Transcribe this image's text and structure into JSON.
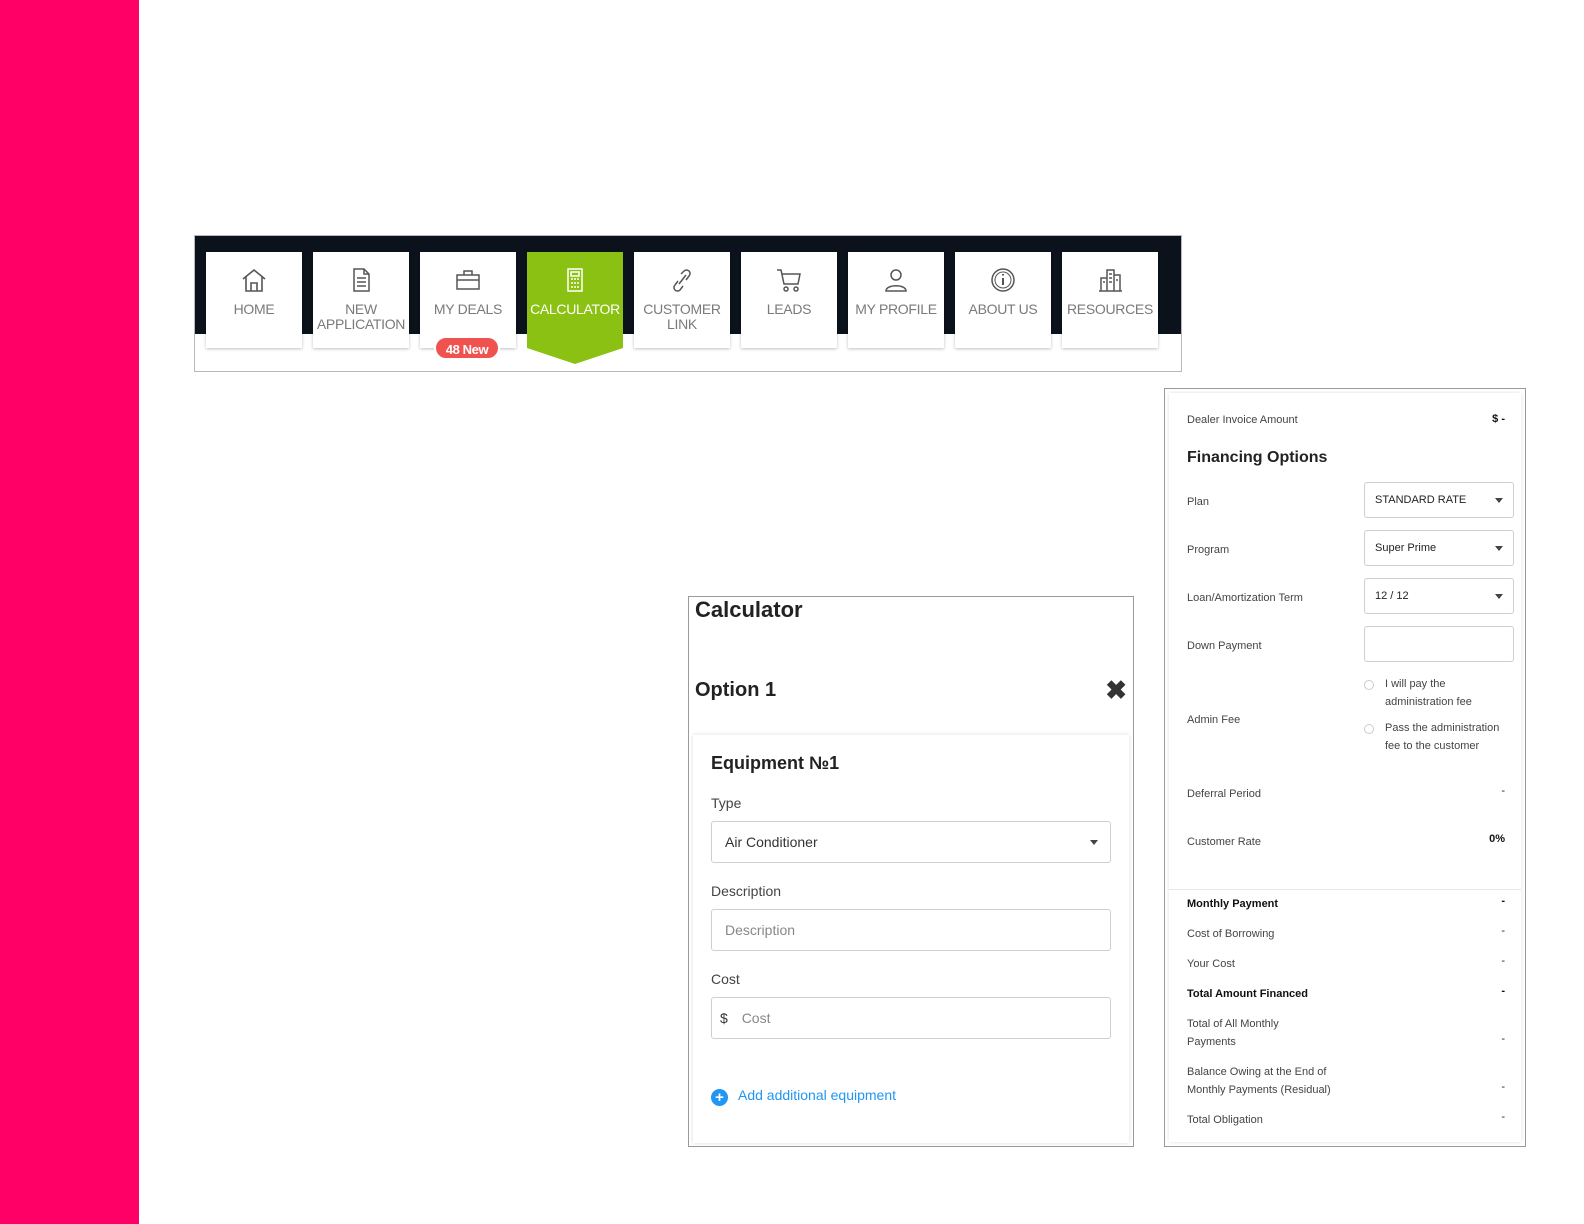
{
  "nav": {
    "items": [
      {
        "label": "HOME",
        "icon": "home-icon"
      },
      {
        "label": "NEW\nAPPLICATION",
        "icon": "document-icon"
      },
      {
        "label": "MY DEALS",
        "icon": "briefcase-icon",
        "badge": "48 New"
      },
      {
        "label": "CALCULATOR",
        "icon": "calculator-icon",
        "active": true
      },
      {
        "label": "CUSTOMER\nLINK",
        "icon": "link-icon"
      },
      {
        "label": "LEADS",
        "icon": "cart-icon"
      },
      {
        "label": "MY PROFILE",
        "icon": "user-icon"
      },
      {
        "label": "ABOUT US",
        "icon": "info-icon"
      },
      {
        "label": "RESOURCES",
        "icon": "buildings-icon"
      }
    ]
  },
  "calculator": {
    "title": "Calculator",
    "option_title": "Option 1",
    "close_symbol": "✖",
    "equipment": {
      "title": "Equipment №1",
      "type_label": "Type",
      "type_value": "Air Conditioner",
      "description_label": "Description",
      "description_placeholder": "Description",
      "cost_label": "Cost",
      "cost_prefix": "$",
      "cost_placeholder": "Cost",
      "add_label": "Add additional equipment"
    }
  },
  "financing": {
    "dealer_invoice_label": "Dealer Invoice Amount",
    "dealer_invoice_value": "$ -",
    "title": "Financing Options",
    "plan_label": "Plan",
    "plan_value": "STANDARD RATE",
    "program_label": "Program",
    "program_value": "Super Prime",
    "term_label": "Loan/Amortization Term",
    "term_value": "12 / 12",
    "down_payment_label": "Down Payment",
    "admin_fee_label": "Admin Fee",
    "admin_fee_option1": "I will pay the administration fee",
    "admin_fee_option2": "Pass the administration fee to the customer",
    "deferral_label": "Deferral Period",
    "deferral_value": "-",
    "customer_rate_label": "Customer Rate",
    "customer_rate_value": "0%",
    "summary": [
      {
        "label": "Monthly Payment",
        "value": "-",
        "bold": true
      },
      {
        "label": "Cost of Borrowing",
        "value": "-"
      },
      {
        "label": "Your Cost",
        "value": "-"
      },
      {
        "label": "Total Amount Financed",
        "value": "-",
        "bold": true
      },
      {
        "label": "Total of All Monthly Payments",
        "value": "-"
      },
      {
        "label": "Balance Owing at the End of Monthly Payments (Residual)",
        "value": "-"
      },
      {
        "label": "Total Obligation",
        "value": "-"
      }
    ]
  },
  "colors": {
    "brand_pink": "#ff0066",
    "nav_dark": "#0b121b",
    "active_green": "#8ac112",
    "badge_red": "#f0524f",
    "link_blue": "#2196f3"
  }
}
